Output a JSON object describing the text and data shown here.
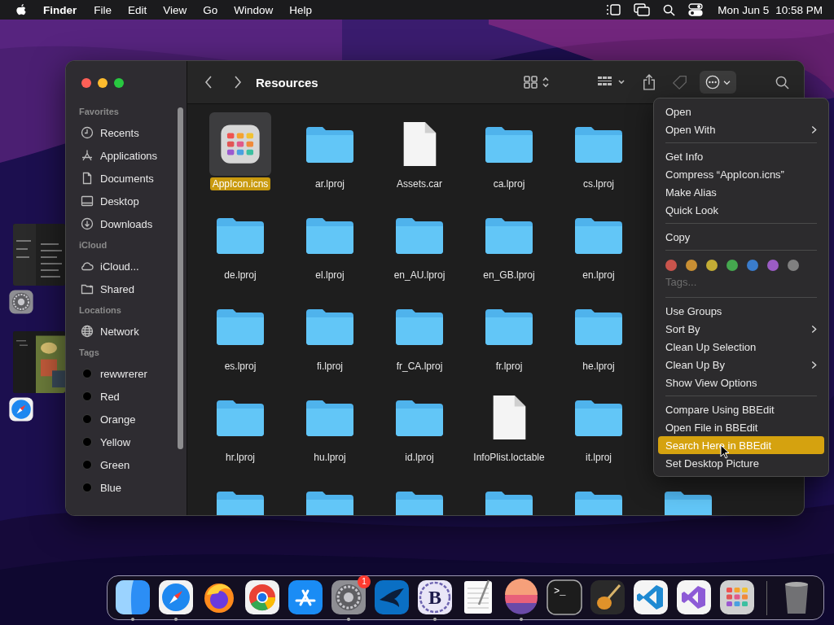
{
  "menubar": {
    "app": "Finder",
    "menus": [
      "File",
      "Edit",
      "View",
      "Go",
      "Window",
      "Help"
    ],
    "date": "Mon Jun 5",
    "time": "10:58 PM"
  },
  "window": {
    "title": "Resources",
    "sidebar": [
      {
        "title": "Favorites",
        "items": [
          {
            "kind": "recents",
            "label": "Recents"
          },
          {
            "kind": "applications",
            "label": "Applications"
          },
          {
            "kind": "documents",
            "label": "Documents"
          },
          {
            "kind": "desktop",
            "label": "Desktop"
          },
          {
            "kind": "downloads",
            "label": "Downloads"
          }
        ]
      },
      {
        "title": "iCloud",
        "items": [
          {
            "kind": "cloud",
            "label": "iCloud..."
          },
          {
            "kind": "shared",
            "label": "Shared"
          }
        ]
      },
      {
        "title": "Locations",
        "items": [
          {
            "kind": "network",
            "label": "Network"
          }
        ]
      },
      {
        "title": "Tags",
        "items": [
          {
            "kind": "tag",
            "label": "rewwrerer"
          },
          {
            "kind": "tag",
            "label": "Red"
          },
          {
            "kind": "tag",
            "label": "Orange"
          },
          {
            "kind": "tag",
            "label": "Yellow"
          },
          {
            "kind": "tag",
            "label": "Green"
          },
          {
            "kind": "tag",
            "label": "Blue"
          }
        ]
      }
    ],
    "rows": [
      [
        {
          "kind": "app",
          "name": "AppIcon.icns",
          "selected": true
        },
        {
          "kind": "folder",
          "name": "ar.lproj",
          "selected": false
        },
        {
          "kind": "document",
          "name": "Assets.car",
          "selected": false
        },
        {
          "kind": "folder",
          "name": "ca.lproj",
          "selected": false
        },
        {
          "kind": "folder",
          "name": "cs.lproj",
          "selected": false
        }
      ],
      [
        {
          "kind": "folder",
          "name": "de.lproj",
          "selected": false
        },
        {
          "kind": "folder",
          "name": "el.lproj",
          "selected": false
        },
        {
          "kind": "folder",
          "name": "en_AU.lproj",
          "selected": false
        },
        {
          "kind": "folder",
          "name": "en_GB.lproj",
          "selected": false
        },
        {
          "kind": "folder",
          "name": "en.lproj",
          "selected": false
        }
      ],
      [
        {
          "kind": "folder",
          "name": "es.lproj",
          "selected": false
        },
        {
          "kind": "folder",
          "name": "fi.lproj",
          "selected": false
        },
        {
          "kind": "folder",
          "name": "fr_CA.lproj",
          "selected": false
        },
        {
          "kind": "folder",
          "name": "fr.lproj",
          "selected": false
        },
        {
          "kind": "folder",
          "name": "he.lproj",
          "selected": false
        }
      ],
      [
        {
          "kind": "folder",
          "name": "hr.lproj",
          "selected": false
        },
        {
          "kind": "folder",
          "name": "hu.lproj",
          "selected": false
        },
        {
          "kind": "folder",
          "name": "id.lproj",
          "selected": false
        },
        {
          "kind": "document",
          "name": "InfoPlist.loctable",
          "selected": false
        },
        {
          "kind": "folder",
          "name": "it.lproj",
          "selected": false
        }
      ],
      [
        {
          "kind": "folder",
          "selected": false
        },
        {
          "kind": "folder",
          "selected": false
        },
        {
          "kind": "folder",
          "selected": false
        },
        {
          "kind": "folder",
          "selected": false
        },
        {
          "kind": "folder",
          "selected": false
        },
        {
          "kind": "folder",
          "selected": false
        }
      ]
    ]
  },
  "context_menu": {
    "groups": [
      {
        "kind": "items",
        "items": [
          {
            "label": "Open",
            "submenu": false,
            "selected": false
          },
          {
            "label": "Open With",
            "submenu": true,
            "selected": false
          }
        ]
      },
      {
        "kind": "items",
        "items": [
          {
            "label": "Get Info",
            "submenu": false,
            "selected": false
          },
          {
            "label": "Compress “AppIcon.icns”",
            "submenu": false,
            "selected": false
          },
          {
            "label": "Make Alias",
            "submenu": false,
            "selected": false
          },
          {
            "label": "Quick Look",
            "submenu": false,
            "selected": false
          }
        ]
      },
      {
        "kind": "items",
        "items": [
          {
            "label": "Copy",
            "submenu": false,
            "selected": false
          }
        ]
      },
      {
        "kind": "tags",
        "colors": [
          {
            "color": "#c9544c"
          },
          {
            "color": "#c98f33"
          },
          {
            "color": "#c4ad35"
          },
          {
            "color": "#45a84f"
          },
          {
            "color": "#3a7ccc"
          },
          {
            "color": "#9b5cc4"
          },
          {
            "color": "#808080"
          }
        ],
        "hint": "Tags..."
      },
      {
        "kind": "items",
        "items": [
          {
            "label": "Use Groups",
            "submenu": false,
            "selected": false
          },
          {
            "label": "Sort By",
            "submenu": true,
            "selected": false
          },
          {
            "label": "Clean Up Selection",
            "submenu": false,
            "selected": false
          },
          {
            "label": "Clean Up By",
            "submenu": true,
            "selected": false
          },
          {
            "label": "Show View Options",
            "submenu": false,
            "selected": false
          }
        ]
      },
      {
        "kind": "items",
        "items": [
          {
            "label": "Compare Using BBEdit",
            "submenu": false,
            "selected": false
          },
          {
            "label": "Open File in BBEdit",
            "submenu": false,
            "selected": false
          },
          {
            "label": "Search Here in BBEdit",
            "submenu": false,
            "selected": true
          },
          {
            "label": "Set Desktop Picture",
            "submenu": false,
            "selected": false
          }
        ]
      }
    ]
  },
  "dock": [
    {
      "kind": "finder",
      "running": true
    },
    {
      "kind": "safari",
      "running": true
    },
    {
      "kind": "firefox",
      "running": false
    },
    {
      "kind": "chrome",
      "running": false
    },
    {
      "kind": "appstore",
      "running": false
    },
    {
      "kind": "settings",
      "running": true,
      "badge": "1"
    },
    {
      "kind": "bird",
      "running": false
    },
    {
      "kind": "bbedit",
      "running": true,
      "glyph": "B"
    },
    {
      "kind": "textedit",
      "running": false
    },
    {
      "kind": "sphere",
      "running": true
    },
    {
      "kind": "terminal",
      "running": false,
      "glyph": ">_"
    },
    {
      "kind": "guitar",
      "running": false
    },
    {
      "kind": "vscode",
      "running": false
    },
    {
      "kind": "vs",
      "running": false
    },
    {
      "kind": "launchpad",
      "running": false
    },
    {
      "kind": "separator"
    },
    {
      "kind": "trash",
      "running": false
    }
  ]
}
